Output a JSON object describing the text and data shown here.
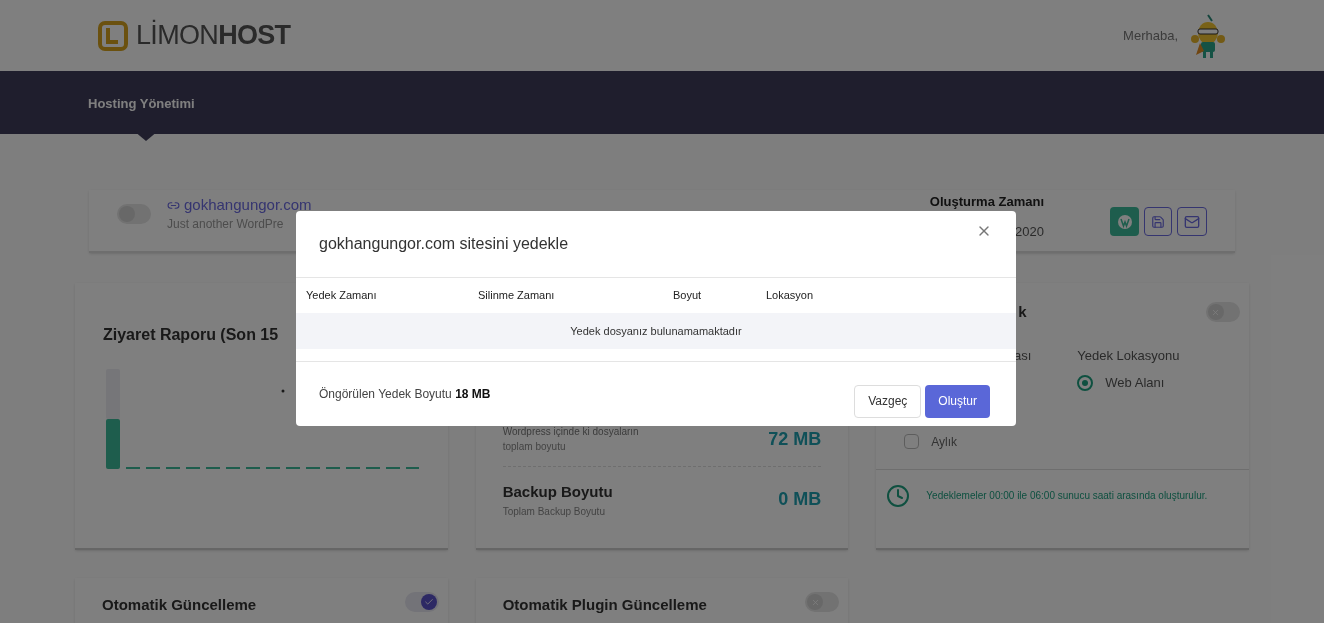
{
  "header": {
    "logo": {
      "light": "LİMON",
      "bold": "HOST"
    },
    "greeting": "Merhaba,"
  },
  "nav": {
    "items": [
      {
        "label": "Hosting Yönetimi",
        "selected": true
      }
    ]
  },
  "site": {
    "domain": "gokhangungor.com",
    "tagline": "Just another WordPre",
    "created_label": "Oluşturma Zamanı",
    "created_value": "2020",
    "switch_on": false
  },
  "visit_card": {
    "title": "Ziyaret Raporu (Son 15"
  },
  "size_card": {
    "rows": [
      {
        "label": "Wordpress içinde ki dosyaların",
        "sub": "toplam boyutu",
        "value": "72 MB"
      },
      {
        "label": "Backup Boyutu",
        "sub": "Toplam Backup Boyutu",
        "value": "0 MB"
      }
    ]
  },
  "backup_card": {
    "title_fragment": "k",
    "switch_on": false,
    "column_1_fragment": "ası",
    "location_label": "Yedek Lokasyonu",
    "locations": [
      {
        "label": "Web Alanı",
        "selected": true
      }
    ],
    "frequencies": [
      {
        "label": "Aylık",
        "checked": false
      }
    ],
    "note": "Yedeklemeler 00:00 ile 06:00 sunucu saati arasında oluşturulur."
  },
  "bottom_cards": [
    {
      "title": "Otomatik Güncelleme",
      "on": true
    },
    {
      "title": "Otomatik Plugin Güncelleme",
      "on": false
    }
  ],
  "modal": {
    "title": "gokhangungor.com sitesini yedekle",
    "columns": [
      "Yedek Zamanı",
      "Silinme Zamanı",
      "Boyut",
      "Lokasyon"
    ],
    "empty_message": "Yedek dosyanız bulunamamaktadır",
    "estimate_label": "Öngörülen Yedek Boyutu",
    "estimate_value": "18 MB",
    "buttons": [
      {
        "label": "Vazgeç",
        "kind": "secondary"
      },
      {
        "label": "Oluştur",
        "kind": "primary"
      }
    ]
  }
}
